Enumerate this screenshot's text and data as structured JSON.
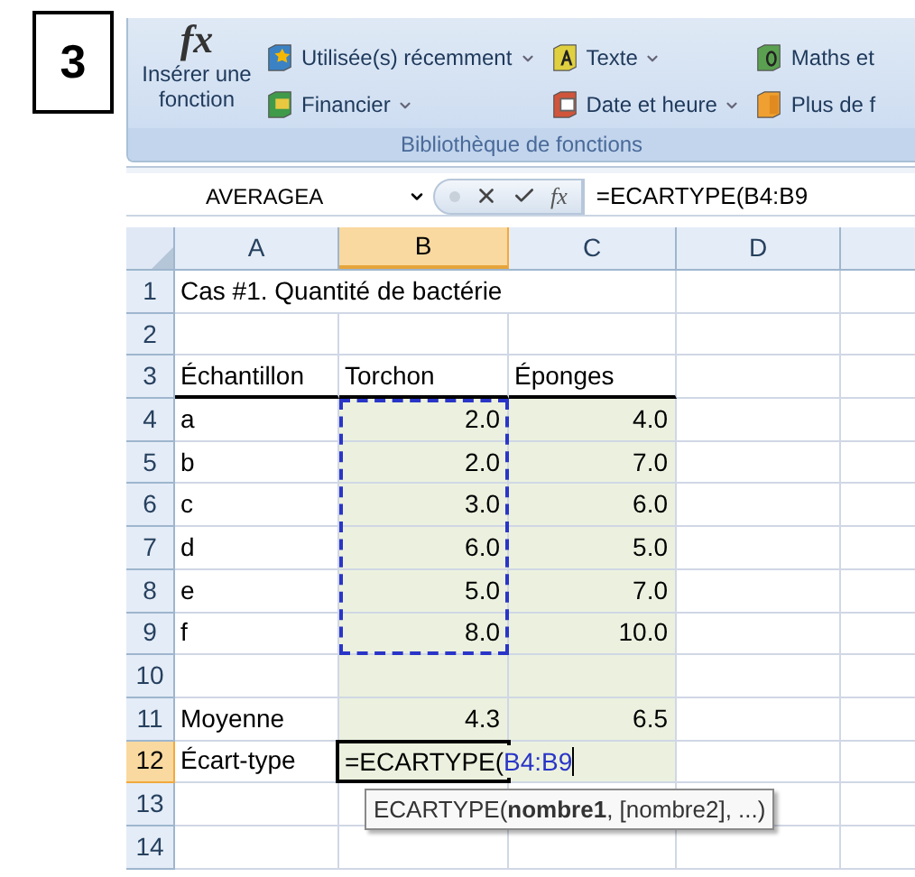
{
  "step": "3",
  "ribbon": {
    "insert_function": {
      "glyph": "fx",
      "label": "Insérer une fonction"
    },
    "buttons": [
      {
        "label": "Utilisée(s) récemment",
        "kind": "recent",
        "dropdown": true
      },
      {
        "label": "Financier",
        "kind": "financial",
        "dropdown": true
      },
      {
        "label": "Texte",
        "kind": "text",
        "dropdown": true
      },
      {
        "label": "Date et heure",
        "kind": "date",
        "dropdown": true
      },
      {
        "label": "Maths et",
        "kind": "math",
        "dropdown": false
      },
      {
        "label": "Plus de f",
        "kind": "more",
        "dropdown": false
      }
    ],
    "group_label": "Bibliothèque de fonctions"
  },
  "formula_bar": {
    "name_box": "AVERAGEA",
    "fx": "fx",
    "formula": "=ECARTYPE(B4:B9"
  },
  "columns": [
    {
      "label": "A",
      "selected": false
    },
    {
      "label": "B",
      "selected": true
    },
    {
      "label": "C",
      "selected": false
    },
    {
      "label": "D",
      "selected": false
    }
  ],
  "rows": [
    {
      "number": "1",
      "selected": false,
      "a": "Cas #1. Quantité de bactérie"
    },
    {
      "number": "2",
      "selected": false
    },
    {
      "number": "3",
      "selected": false,
      "a": "Échantillon",
      "b": "Torchon",
      "c": "Éponges",
      "underlined": true
    },
    {
      "number": "4",
      "selected": false,
      "a": "a",
      "b": "2.0",
      "c": "4.0",
      "shaded": true,
      "in_range": true
    },
    {
      "number": "5",
      "selected": false,
      "a": "b",
      "b": "2.0",
      "c": "7.0",
      "shaded": true,
      "in_range": true
    },
    {
      "number": "6",
      "selected": false,
      "a": "c",
      "b": "3.0",
      "c": "6.0",
      "shaded": true,
      "in_range": true
    },
    {
      "number": "7",
      "selected": false,
      "a": "d",
      "b": "6.0",
      "c": "5.0",
      "shaded": true,
      "in_range": true
    },
    {
      "number": "8",
      "selected": false,
      "a": "e",
      "b": "5.0",
      "c": "7.0",
      "shaded": true,
      "in_range": true
    },
    {
      "number": "9",
      "selected": false,
      "a": "f",
      "b": "8.0",
      "c": "10.0",
      "shaded": true,
      "in_range": true
    },
    {
      "number": "10",
      "selected": false,
      "shaded": true
    },
    {
      "number": "11",
      "selected": false,
      "a": "Moyenne",
      "b": "4.3",
      "c": "6.5",
      "shaded": true
    },
    {
      "number": "12",
      "selected": true,
      "a": "Écart-type",
      "editing": {
        "formula": "=ECARTYPE(",
        "reference": "B4:B9",
        "tooltip": "ECARTYPE(**nombre1**, [nombre2], ...)"
      },
      "shaded": true
    },
    {
      "number": "13",
      "selected": false
    },
    {
      "number": "14",
      "selected": false
    }
  ]
}
